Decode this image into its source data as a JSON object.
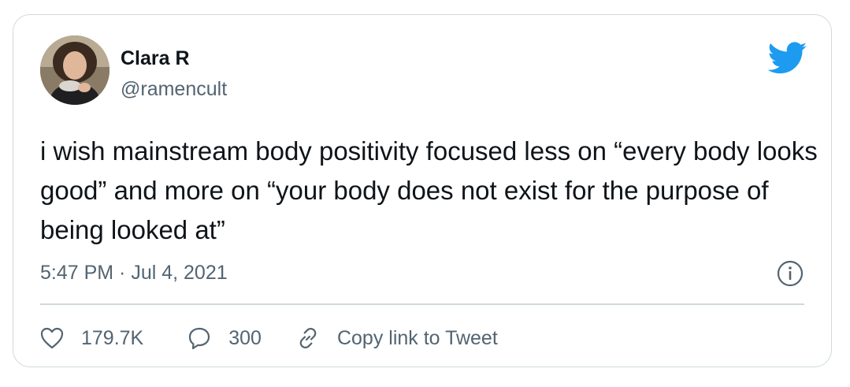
{
  "author": {
    "name": "Clara R",
    "handle": "@ramencult",
    "avatar_icon": "avatar-photo"
  },
  "brand": {
    "icon": "twitter-bird-icon",
    "color": "#1d9bf0"
  },
  "tweet": {
    "text": "i wish mainstream body positivity focused less on “every body looks good” and more on “your body does not exist for the purpose of being looked at”",
    "timestamp": "5:47 PM · Jul 4, 2021"
  },
  "actions": {
    "like_count": "179.7K",
    "reply_count": "300",
    "copy_link_label": "Copy link to Tweet"
  },
  "colors": {
    "text_primary": "#0f1419",
    "text_secondary": "#536471",
    "border": "#cfd9de"
  }
}
